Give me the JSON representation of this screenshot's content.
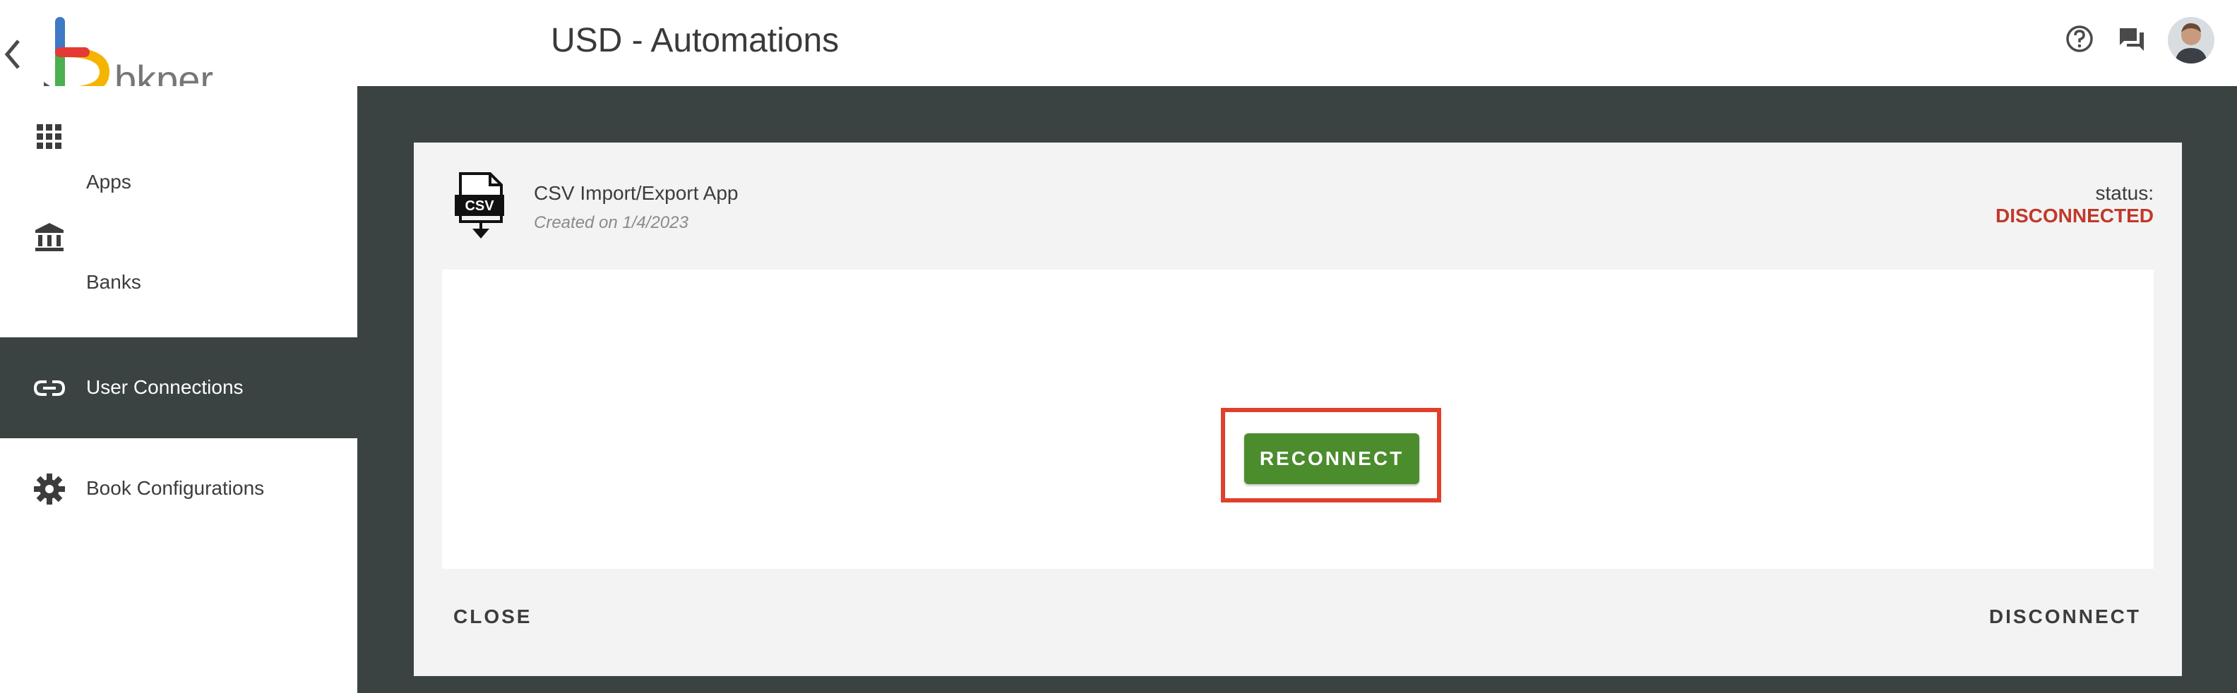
{
  "header": {
    "title": "USD - Automations",
    "logo_text": "bkper",
    "icons": [
      "back-icon",
      "help-icon",
      "chat-icon",
      "avatar"
    ]
  },
  "sidebar": {
    "items": [
      {
        "label": "Apps",
        "icon": "apps-grid-icon",
        "active": false
      },
      {
        "label": "Banks",
        "icon": "bank-icon",
        "active": false
      },
      {
        "label": "User Connections",
        "icon": "link-icon",
        "active": true
      },
      {
        "label": "Book Configurations",
        "icon": "gear-icon",
        "active": false
      }
    ]
  },
  "connection_card": {
    "icon": "csv-file-icon",
    "icon_text": "CSV",
    "app_name": "CSV Import/Export App",
    "created": "Created on 1/4/2023",
    "status_label": "status:",
    "status_value": "DISCONNECTED",
    "reconnect_label": "RECONNECT",
    "close_label": "CLOSE",
    "disconnect_label": "DISCONNECT"
  },
  "colors": {
    "sidebar_active_bg": "#3b4242",
    "main_bg": "#3b4242",
    "status_disconnected": "#c0392b",
    "reconnect_button": "#4b8c2c",
    "highlight_border": "#e0402a"
  }
}
